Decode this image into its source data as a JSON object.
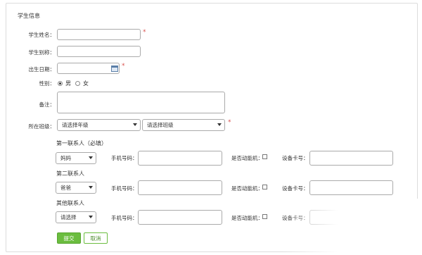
{
  "section": {
    "title": "学生信息"
  },
  "fields": {
    "name_label": "学生姓名：",
    "nickname_label": "学生别称：",
    "birthday_label": "出生日期：",
    "gender_label": "性别：",
    "gender_male": "男",
    "gender_female": "女",
    "note_label": "备注：",
    "class_label": "所在班级：",
    "grade_select": "请选择年级",
    "class_select": "请选择班级",
    "required_mark": "*"
  },
  "contacts": {
    "first_title": "第一联系人（必填）",
    "second_title": "第二联系人",
    "other_title": "其他联系人",
    "first_relation": "妈妈",
    "second_relation": "爸爸",
    "other_relation": "请选择",
    "phone_label": "手机号码：",
    "mobile_label": "是否动能机：",
    "card_label": "设备卡号："
  },
  "actions": {
    "submit": "提交",
    "cancel": "取消"
  },
  "state": {
    "gender_selected": "male"
  },
  "colors": {
    "accent": "#6bbd3f",
    "required": "#d9534f"
  }
}
